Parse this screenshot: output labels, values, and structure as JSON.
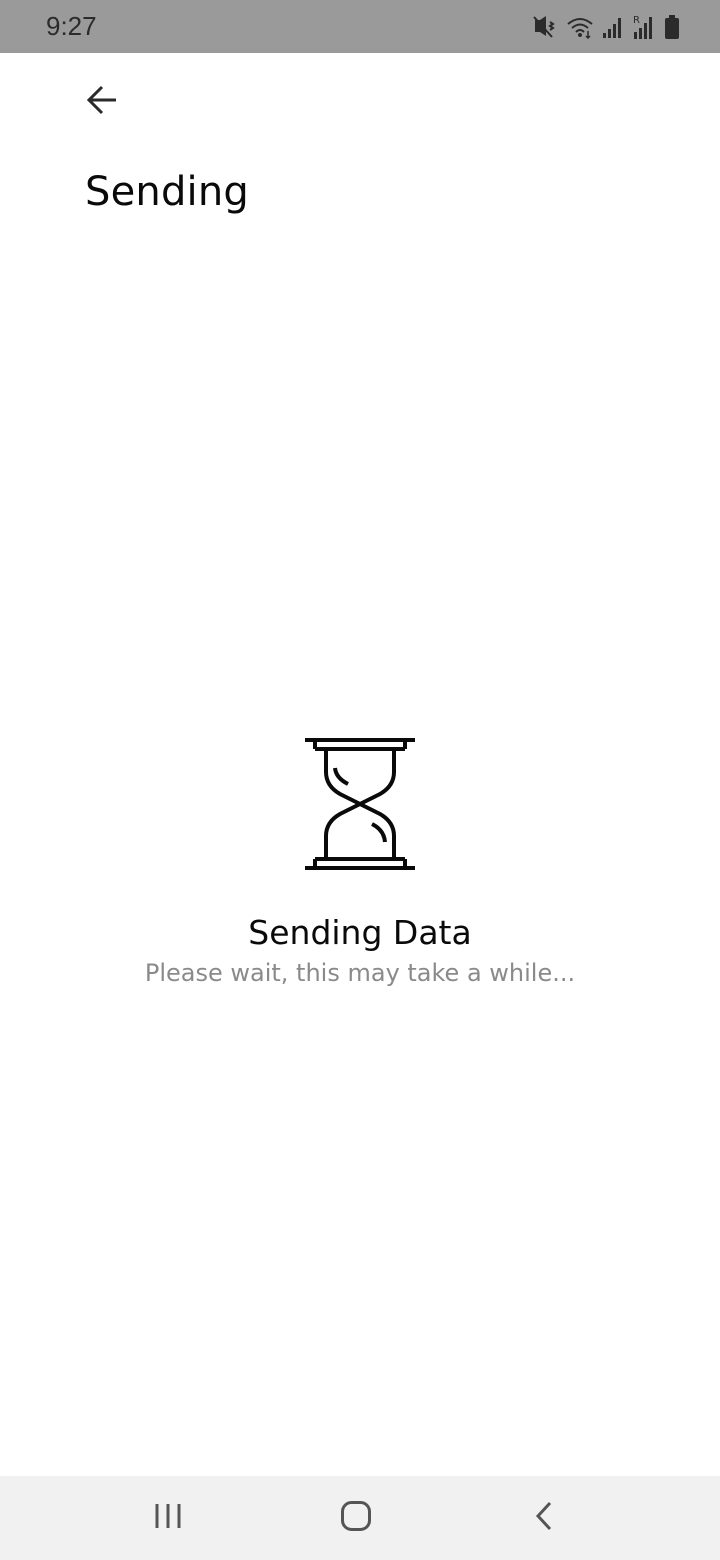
{
  "status_bar": {
    "time": "9:27",
    "icons": [
      "mute-vibrate-icon",
      "wifi-icon",
      "signal-icon",
      "signal-roaming-icon",
      "battery-icon"
    ]
  },
  "header": {
    "back_icon": "arrow-left-icon",
    "title": "Sending"
  },
  "main": {
    "icon": "hourglass-icon",
    "heading": "Sending Data",
    "subtext": "Please wait, this may take a while..."
  },
  "nav_bar": {
    "buttons": [
      "recent-apps-icon",
      "home-icon",
      "back-icon"
    ]
  },
  "colors": {
    "status_bar_bg": "#9a9a9a",
    "nav_bar_bg": "#f1f1f1",
    "text_primary": "#0a0a0a",
    "text_secondary": "#8a8a8a"
  }
}
